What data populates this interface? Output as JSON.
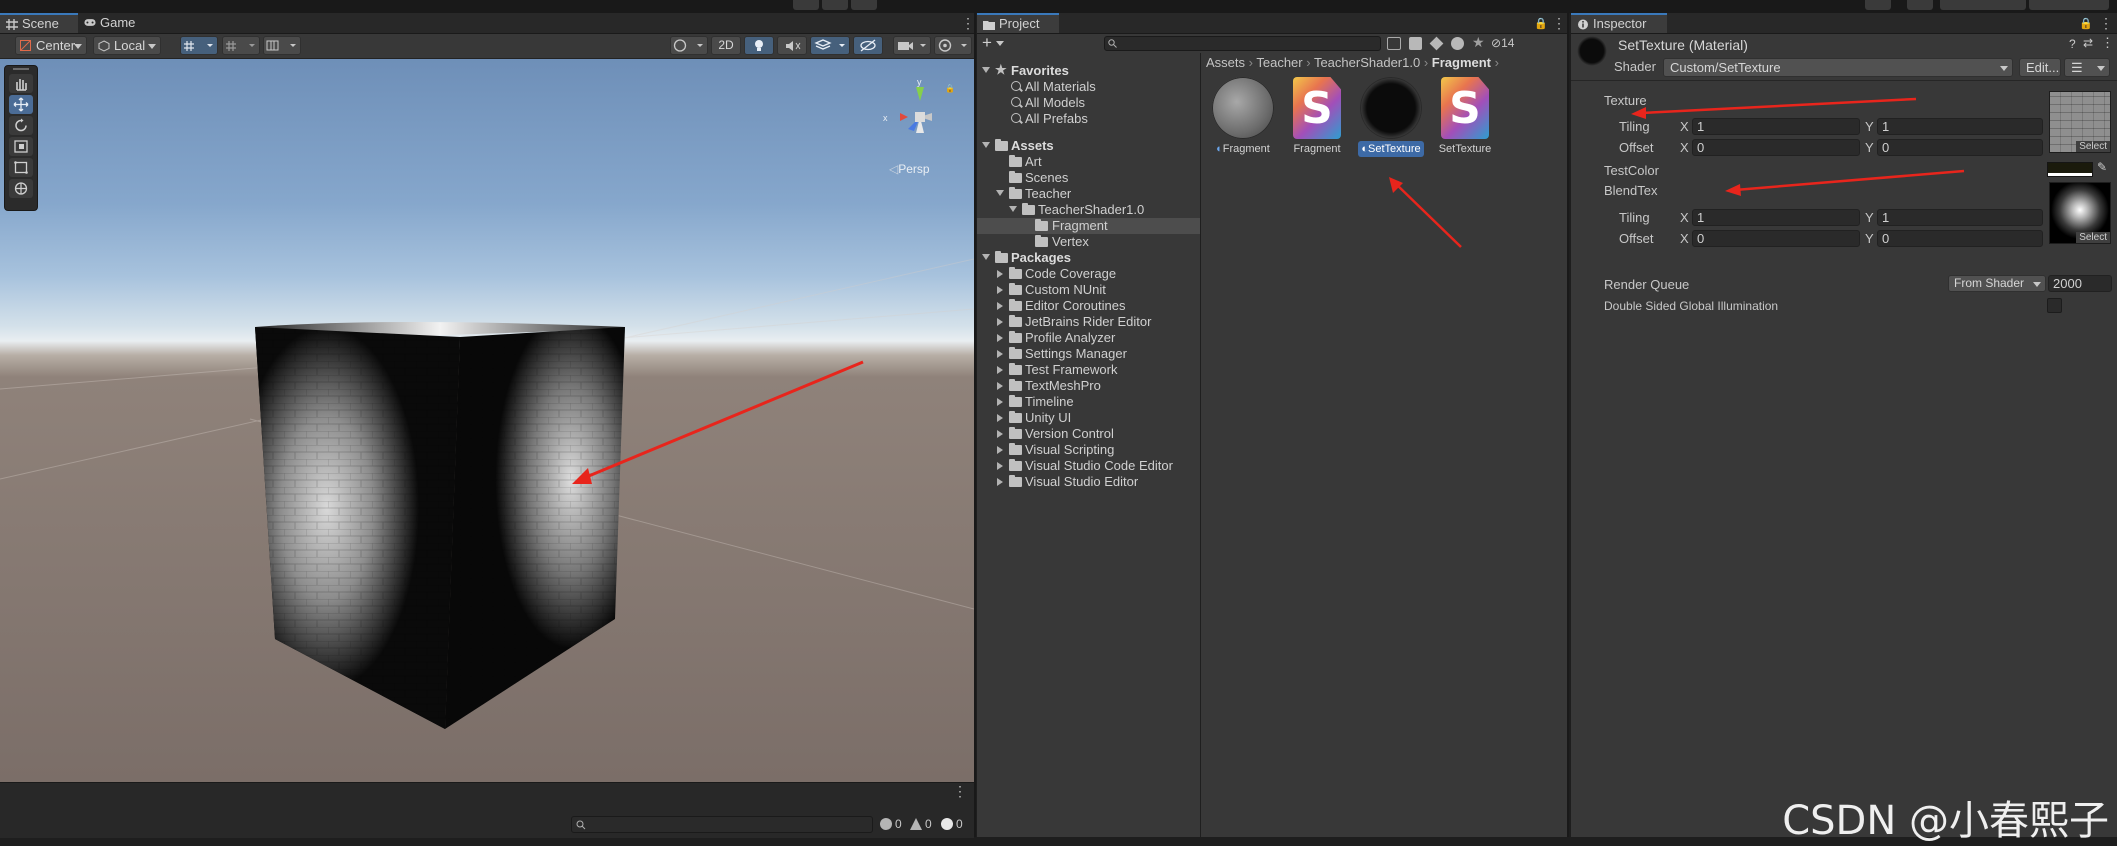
{
  "scene_panel": {
    "tabs": [
      {
        "label": "Scene",
        "icon": "hash-grid-icon"
      },
      {
        "label": "Game",
        "icon": "gamepad-icon"
      }
    ],
    "toolbar": {
      "pivot_mode": "Center",
      "pivot_rotation": "Local",
      "mode_2d": "2D"
    },
    "gizmo": {
      "x": "x",
      "y": "y",
      "view": "Persp"
    },
    "console": {
      "error_count": "0",
      "warning_count": "0",
      "info_count": "0"
    }
  },
  "project_panel": {
    "tab_label": "Project",
    "hidden_count": "14",
    "favorites": {
      "label": "Favorites",
      "items": [
        "All Materials",
        "All Models",
        "All Prefabs"
      ]
    },
    "assets": {
      "label": "Assets",
      "children": [
        "Art",
        "Scenes",
        "Teacher",
        "TeacherShader1.0",
        "Fragment",
        "Vertex"
      ]
    },
    "packages": {
      "label": "Packages",
      "items": [
        "Code Coverage",
        "Custom NUnit",
        "Editor Coroutines",
        "JetBrains Rider Editor",
        "Profile Analyzer",
        "Settings Manager",
        "Test Framework",
        "TextMeshPro",
        "Timeline",
        "Unity UI",
        "Version Control",
        "Visual Scripting",
        "Visual Studio Code Editor",
        "Visual Studio Editor"
      ]
    },
    "breadcrumb": [
      "Assets",
      "Teacher",
      "TeacherShader1.0",
      "Fragment"
    ],
    "grid_items": [
      {
        "label": "Fragment",
        "kind": "material"
      },
      {
        "label": "Fragment",
        "kind": "shader",
        "glyph": "S"
      },
      {
        "label": "SetTexture",
        "kind": "material",
        "selected": true
      },
      {
        "label": "SetTexture",
        "kind": "shader",
        "glyph": "S"
      }
    ]
  },
  "inspector": {
    "tab_label": "Inspector",
    "title": "SetTexture (Material)",
    "shader_label": "Shader",
    "shader_value": "Custom/SetTexture",
    "edit_button": "Edit...",
    "texture": {
      "label": "Texture",
      "tiling_label": "Tiling",
      "offset_label": "Offset",
      "tiling_x": "1",
      "tiling_y": "1",
      "offset_x": "0",
      "offset_y": "0",
      "select": "Select"
    },
    "test_color_label": "TestColor",
    "blend_tex": {
      "label": "BlendTex",
      "tiling_label": "Tiling",
      "offset_label": "Offset",
      "tiling_x": "1",
      "tiling_y": "1",
      "offset_x": "0",
      "offset_y": "0",
      "select": "Select"
    },
    "axis_x": "X",
    "axis_y": "Y",
    "render_queue_label": "Render Queue",
    "render_queue_mode": "From Shader",
    "render_queue_value": "2000",
    "dsgi_label": "Double Sided Global Illumination"
  },
  "watermark": "CSDN @小春熙子",
  "colors": {
    "accent": "#3a79bb",
    "selection": "#3d6aa6",
    "annotation_arrow": "#e8251c"
  }
}
